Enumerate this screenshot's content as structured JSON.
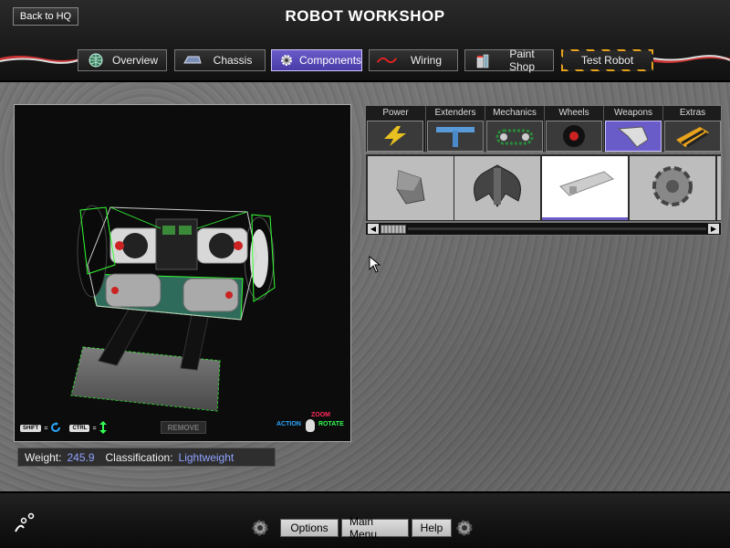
{
  "header": {
    "title": "ROBOT WORKSHOP",
    "back_label": "Back to HQ"
  },
  "tabs": [
    {
      "label": "Overview",
      "icon": "globe-icon"
    },
    {
      "label": "Chassis",
      "icon": "chassis-icon"
    },
    {
      "label": "Components",
      "icon": "gear-icon",
      "active": true
    },
    {
      "label": "Wiring",
      "icon": "wire-icon"
    },
    {
      "label": "Paint Shop",
      "icon": "paint-can-icon"
    },
    {
      "label": "Test Robot",
      "icon": ""
    }
  ],
  "viewport": {
    "remove_label": "REMOVE",
    "shift_key": "SHIFT",
    "ctrl_key": "CTRL",
    "equals": "=",
    "mouse_zoom": "ZOOM",
    "mouse_action": "ACTION",
    "mouse_rotate": "ROTATE"
  },
  "status": {
    "weight_label": "Weight:",
    "weight_value": "245.9",
    "class_label": "Classification:",
    "class_value": "Lightweight"
  },
  "categories": [
    {
      "label": "Power",
      "icon": "lightning-icon"
    },
    {
      "label": "Extenders",
      "icon": "extender-icon"
    },
    {
      "label": "Mechanics",
      "icon": "chain-icon"
    },
    {
      "label": "Wheels",
      "icon": "wheel-icon"
    },
    {
      "label": "Weapons",
      "icon": "blade-icon",
      "active": true
    },
    {
      "label": "Extras",
      "icon": "hazard-icon"
    }
  ],
  "parts": [
    {
      "icon": "wedge-blade-icon"
    },
    {
      "icon": "axe-blade-icon"
    },
    {
      "icon": "flipper-plate-icon",
      "selected": true
    },
    {
      "icon": "spinner-disc-icon"
    }
  ],
  "bottom": {
    "options_label": "Options",
    "main_menu_label": "Main Menu",
    "help_label": "Help"
  },
  "colors": {
    "accent": "#6a5cc8",
    "status_value": "#8fa2ff",
    "bounding_box": "#33ff33"
  }
}
